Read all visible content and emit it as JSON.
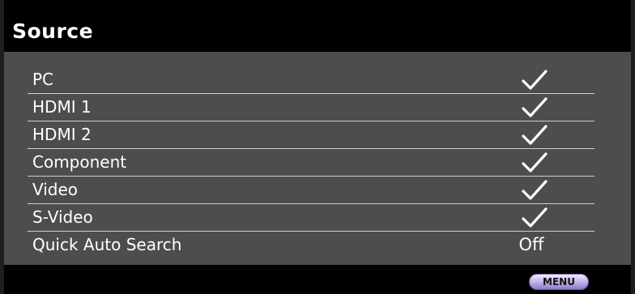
{
  "title": "Source",
  "items": [
    {
      "label": "PC",
      "checked": true,
      "value": null
    },
    {
      "label": "HDMI 1",
      "checked": true,
      "value": null
    },
    {
      "label": "HDMI 2",
      "checked": true,
      "value": null
    },
    {
      "label": "Component",
      "checked": true,
      "value": null
    },
    {
      "label": "Video",
      "checked": true,
      "value": null
    },
    {
      "label": "S-Video",
      "checked": true,
      "value": null
    },
    {
      "label": "Quick Auto Search",
      "checked": false,
      "value": "Off"
    }
  ],
  "footer": {
    "menu_label": "MENU"
  },
  "icons": {
    "row_mark": "check-icon"
  },
  "colors": {
    "background": "#000000",
    "panel": "#4d4d4d",
    "text": "#ffffff",
    "divider": "#cfcfcf",
    "menu_button": "#b9a6e6"
  }
}
